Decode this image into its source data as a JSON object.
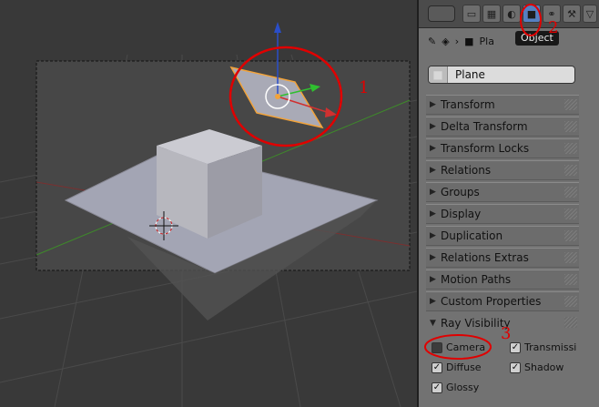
{
  "header": {
    "icons": [
      "render-icon",
      "render-layers-icon",
      "scene-icon",
      "world-icon",
      "object-icon",
      "constraints-icon",
      "modifiers-icon",
      "data-icon"
    ],
    "active_icon": "object-icon",
    "tooltip": "Object"
  },
  "breadcrumb": {
    "object_name": "Pla"
  },
  "name_field": {
    "value": "Plane"
  },
  "sections": [
    {
      "label": "Transform",
      "open": false
    },
    {
      "label": "Delta Transform",
      "open": false
    },
    {
      "label": "Transform Locks",
      "open": false
    },
    {
      "label": "Relations",
      "open": false
    },
    {
      "label": "Groups",
      "open": false
    },
    {
      "label": "Display",
      "open": false
    },
    {
      "label": "Duplication",
      "open": false
    },
    {
      "label": "Relations Extras",
      "open": false
    },
    {
      "label": "Motion Paths",
      "open": false
    },
    {
      "label": "Custom Properties",
      "open": false
    },
    {
      "label": "Ray Visibility",
      "open": true
    }
  ],
  "ray_visibility": {
    "camera": {
      "label": "Camera",
      "checked": false
    },
    "transmission": {
      "label": "Transmissi",
      "checked": true
    },
    "diffuse": {
      "label": "Diffuse",
      "checked": true
    },
    "shadow": {
      "label": "Shadow",
      "checked": true
    },
    "glossy": {
      "label": "Glossy",
      "checked": true
    }
  },
  "annotations": {
    "a1": "1",
    "a2": "2",
    "a3": "3"
  },
  "colors": {
    "annotation": "#e00000",
    "selection": "#f2a33a",
    "active_tab": "#5680c2"
  }
}
